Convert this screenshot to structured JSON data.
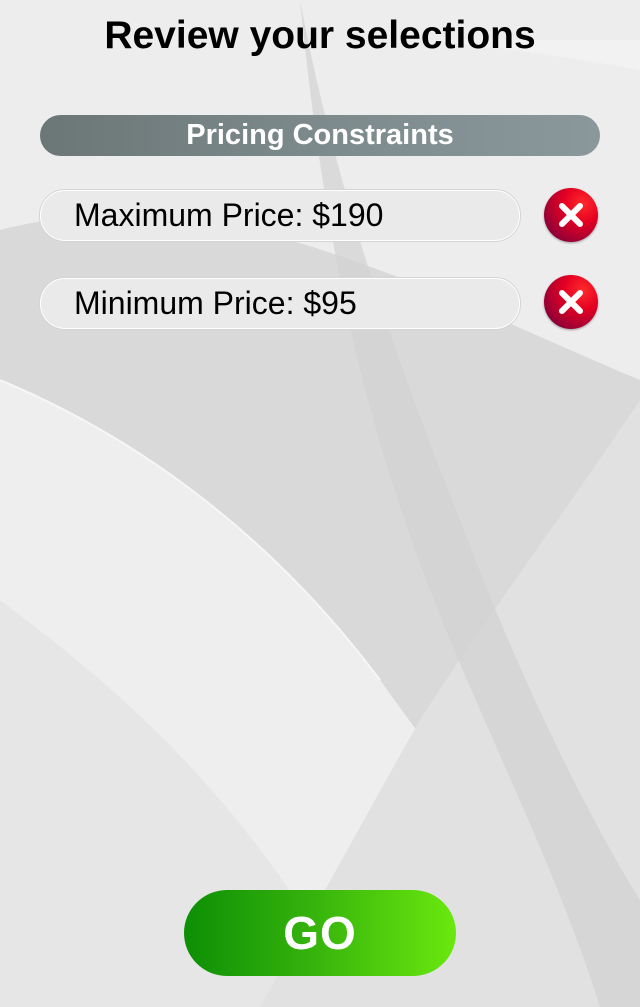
{
  "page": {
    "title": "Review your selections"
  },
  "section": {
    "header": "Pricing Constraints"
  },
  "constraints": [
    {
      "label": "Maximum Price: $190",
      "remove_icon": "close-icon"
    },
    {
      "label": "Minimum Price: $95",
      "remove_icon": "close-icon"
    }
  ],
  "actions": {
    "go_label": "GO"
  },
  "colors": {
    "header_bar": "#7d8a8c",
    "remove_button": "#e50022",
    "go_button_start": "#0d8f05",
    "go_button_end": "#6ae80e"
  }
}
